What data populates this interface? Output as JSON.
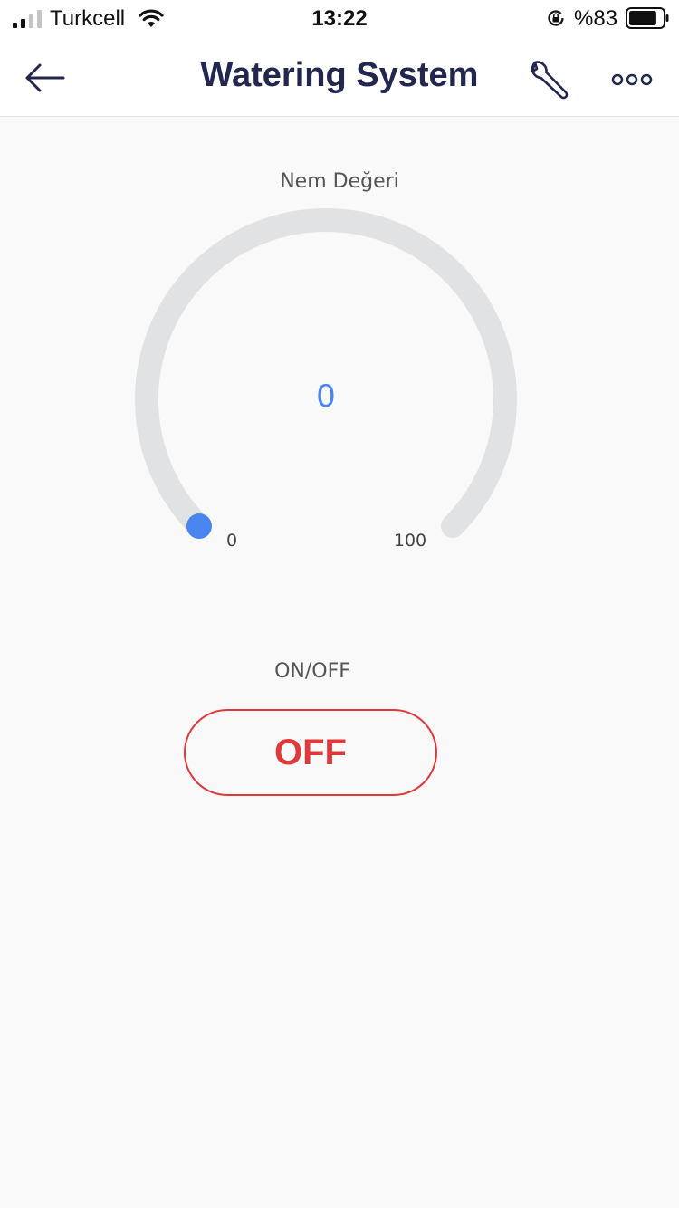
{
  "status_bar": {
    "carrier": "Turkcell",
    "time": "13:22",
    "battery_text": "%83",
    "battery_level": 0.83,
    "signal_bars_active": 2,
    "signal_bars_total": 4
  },
  "header": {
    "title": "Watering System",
    "icons": [
      "arrow-left-icon",
      "wrench-icon",
      "more-horizontal-icon"
    ]
  },
  "gauge": {
    "label": "Nem Değeri",
    "value": "0",
    "min": "0",
    "max": "100",
    "fraction": 0,
    "track_color": "#e1e2e4",
    "indicator_color": "#4a86f0"
  },
  "toggle": {
    "label": "ON/OFF",
    "state_text": "OFF",
    "color": "#e0383b"
  },
  "colors": {
    "title": "#23264f",
    "background": "#f9f9f9"
  }
}
